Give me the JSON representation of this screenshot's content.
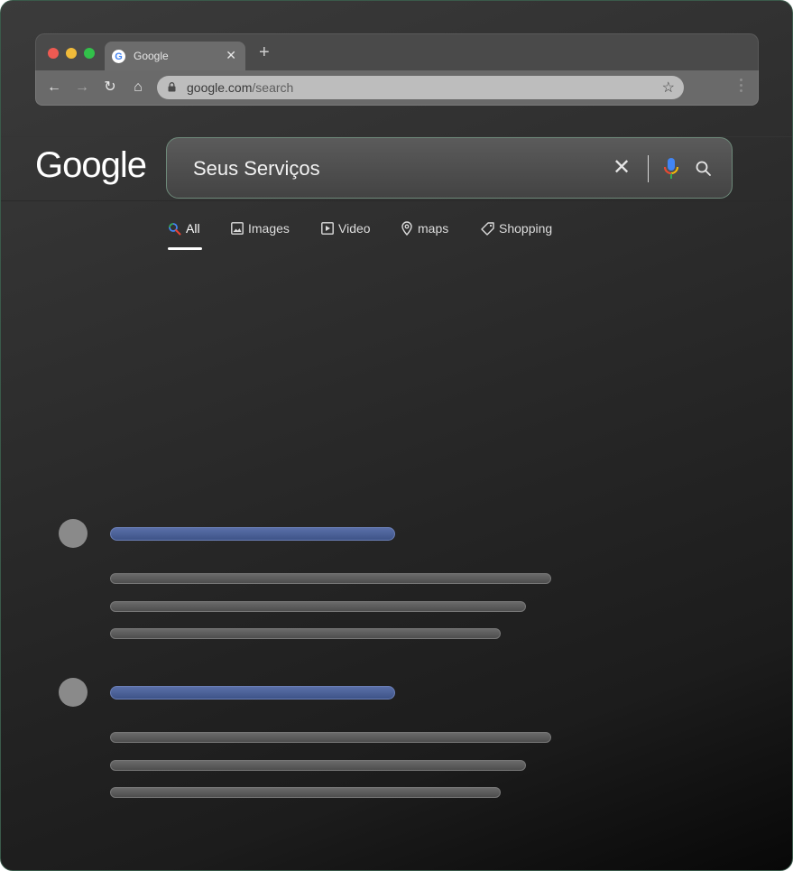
{
  "browser": {
    "tab": {
      "title": "Google",
      "close": "✕"
    },
    "new_tab": "+",
    "nav": {
      "back": "←",
      "forward": "→",
      "reload": "↻",
      "home": "⌂"
    },
    "address": {
      "domain": "google.com",
      "path": "/search"
    },
    "star": "☆"
  },
  "header": {
    "logo": "Google",
    "search": {
      "query": "Seus Serviços",
      "clear": "✕"
    }
  },
  "search_tabs": [
    {
      "label": "All",
      "icon": "search-icon",
      "active": true
    },
    {
      "label": "Images",
      "icon": "image-icon",
      "active": false
    },
    {
      "label": "Video",
      "icon": "play-icon",
      "active": false
    },
    {
      "label": "maps",
      "icon": "map-pin-icon",
      "active": false
    },
    {
      "label": "Shopping",
      "icon": "tag-icon",
      "active": false
    }
  ],
  "results": [
    {
      "type": "placeholder"
    },
    {
      "type": "placeholder"
    }
  ],
  "colors": {
    "background": "#2c2c2c",
    "result_title": "#4a5f9a",
    "result_line": "#5c5c5c",
    "mic_blue": "#4285f4",
    "mic_red": "#ea4335",
    "mic_yellow": "#fbbc05",
    "mic_green": "#34a853"
  }
}
